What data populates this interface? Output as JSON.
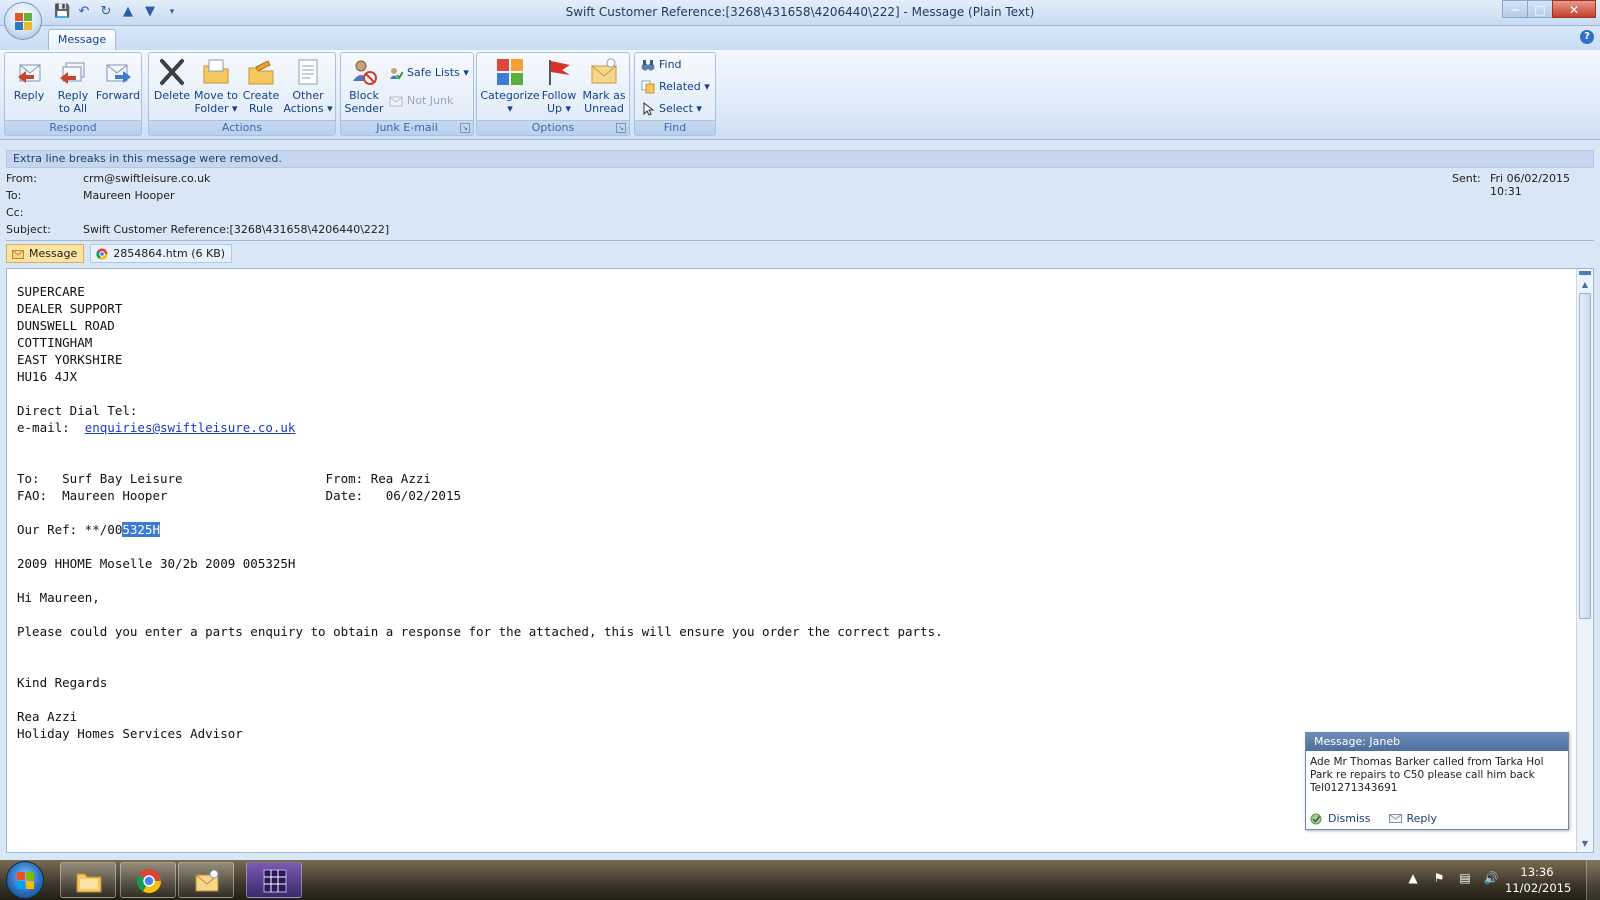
{
  "window": {
    "title": "Swift Customer Reference:[3268\\431658\\4206440\\222] - Message (Plain Text)"
  },
  "ribbon": {
    "tab": "Message",
    "groups": {
      "respond": "Respond",
      "actions": "Actions",
      "junk": "Junk E-mail",
      "options": "Options",
      "find": "Find"
    },
    "buttons": {
      "reply": [
        "Reply",
        ""
      ],
      "reply_all": [
        "Reply",
        "to All"
      ],
      "forward": [
        "Forward",
        ""
      ],
      "delete": [
        "Delete",
        ""
      ],
      "move_to_folder": [
        "Move to",
        "Folder"
      ],
      "create_rule": [
        "Create",
        "Rule"
      ],
      "other_actions": [
        "Other",
        "Actions"
      ],
      "block_sender": [
        "Block",
        "Sender"
      ],
      "safe_lists": "Safe Lists",
      "not_junk": "Not Junk",
      "categorize": [
        "Categorize",
        ""
      ],
      "follow_up": [
        "Follow",
        "Up"
      ],
      "mark_as_unread": [
        "Mark as",
        "Unread"
      ],
      "find": "Find",
      "related": "Related",
      "select": "Select"
    }
  },
  "infobar": "Extra line breaks in this message were removed.",
  "header": {
    "from_label": "From:",
    "from_value": "crm@swiftleisure.co.uk",
    "to_label": "To:",
    "to_value": "Maureen Hooper",
    "cc_label": "Cc:",
    "cc_value": "",
    "subject_label": "Subject:",
    "subject_value": "Swift Customer Reference:[3268\\431658\\4206440\\222]",
    "sent_label": "Sent:",
    "sent_value": "Fri 06/02/2015 10:31"
  },
  "attachments": [
    {
      "label": "Message"
    },
    {
      "label": "2854864.htm (6 KB)"
    }
  ],
  "body": {
    "address": "SUPERCARE\nDEALER SUPPORT\nDUNSWELL ROAD\nCOTTINGHAM\nEAST YORKSHIRE\nHU16 4JX",
    "direct_dial": "Direct Dial Tel:",
    "email_label": "e-mail:  ",
    "email_link": "enquiries@swiftleisure.co.uk",
    "to_line": "To:   Surf Bay Leisure                   From: Rea Azzi",
    "fao_line": "FAO:  Maureen Hooper                     Date:   06/02/2015",
    "ref_prefix": "Our Ref: **/00",
    "ref_selected": "5325H",
    "model_line": "2009 HHOME Moselle 30/2b 2009 005325H",
    "greeting": "Hi Maureen,",
    "message": "Please could you enter a parts enquiry to obtain a response for the attached, this will ensure you order the correct parts.",
    "closing": "Kind Regards",
    "signature_name": "Rea Azzi",
    "signature_title": "Holiday Homes Services Advisor"
  },
  "popup": {
    "title": "Message: Janeb",
    "text": "Ade Mr Thomas Barker called  from Tarka Hol Park re repairs to C50 please call him back Tel01271343691",
    "dismiss": "Dismiss",
    "reply": "Reply"
  },
  "taskbar": {
    "time": "13:36",
    "date": "11/02/2015"
  },
  "colors": {
    "accent": "#15428b",
    "selection": "#3a7bd5",
    "link": "#1b39c9"
  }
}
